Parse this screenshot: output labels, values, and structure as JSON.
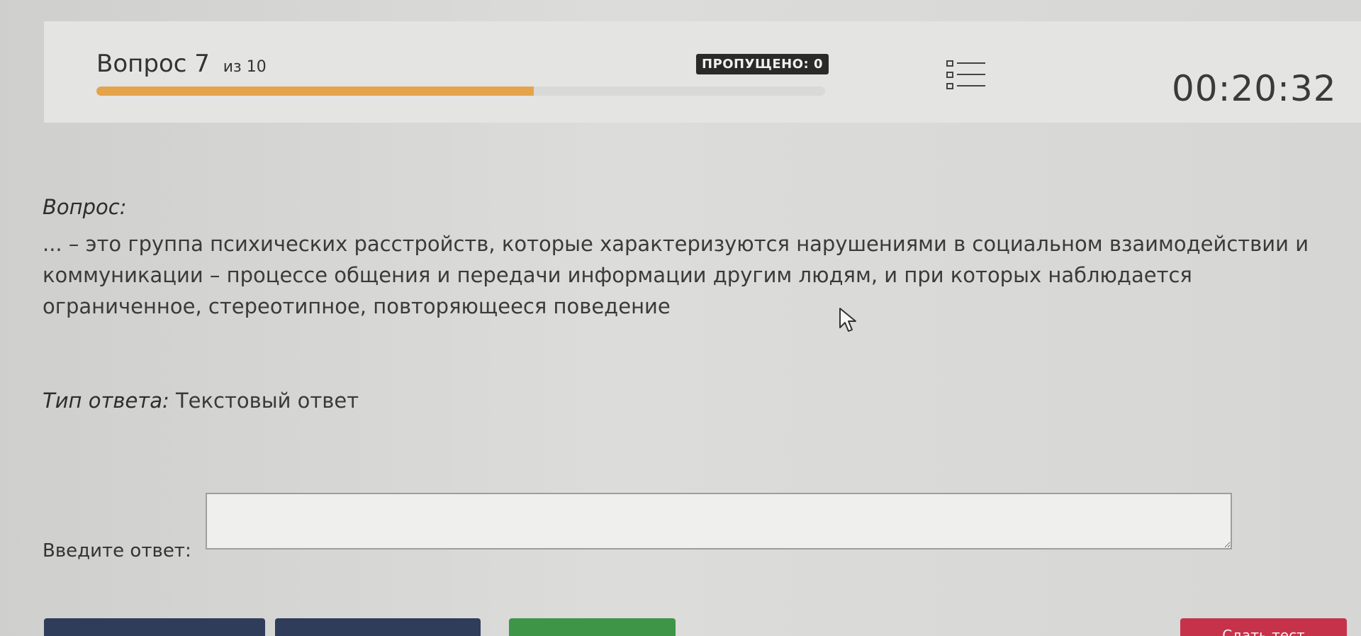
{
  "header": {
    "question_word": "Вопрос",
    "question_number": "7",
    "question_total": "из 10",
    "progress": 0.6,
    "skipped": "ПРОПУЩЕНО: 0",
    "timer": "00:20:32"
  },
  "question": {
    "label": "Вопрос:",
    "text": "... – это группа психических расстройств, которые характеризуются нарушениями в социальном взаимодействии и коммуникации – процессе общения и передачи информации другим людям, и при которых наблюдается ограниченное, стереотипное, повторяющееся поведение"
  },
  "answer_type": {
    "label": "Тип ответа:",
    "value": "Текстовый ответ"
  },
  "answer": {
    "label": "Введите ответ:",
    "value": ""
  },
  "buttons": {
    "finish": "Сдать тест"
  },
  "colors": {
    "progress": "#e3a44b",
    "nav_button": "#2f3c5a",
    "answer_button": "#3e9548",
    "finish_button": "#c5324a"
  },
  "icons": {
    "question_list": "list-icon",
    "cursor": "mouse-cursor-icon"
  }
}
